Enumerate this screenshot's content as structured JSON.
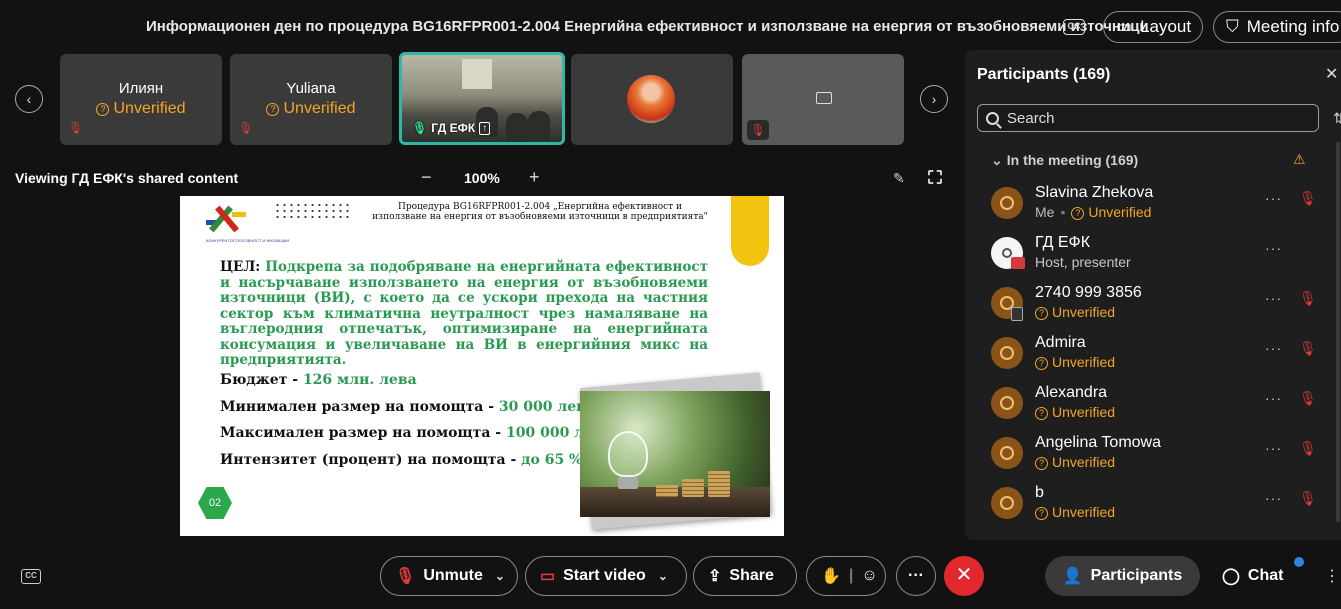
{
  "top": {
    "meeting_title": "Информационен ден по процедура BG16RFPR001-2.004 Енергийна ефективност и използване на енергия от възобновяеми източници",
    "cc_label": "CC",
    "layout_label": "Layout",
    "meeting_info_label": "Meeting info"
  },
  "thumbnails": [
    {
      "name": "Илиян",
      "status": "Unverified"
    },
    {
      "name": "Yuliana",
      "status": "Unverified"
    },
    {
      "name": "ГД ЕФК"
    },
    {
      "name": ""
    },
    {
      "name": ""
    }
  ],
  "share": {
    "viewing_label": "Viewing ГД ЕФК's shared content",
    "zoom": "100%",
    "zoom_minus": "−",
    "zoom_plus": "+"
  },
  "slide": {
    "header": "Процедура BG16RFPR001-2.004 „Енергийна ефективност и използване на енергия от възобновяеми източници в предприятията\"",
    "goal_label": "ЦЕЛ:",
    "goal_text": " Подкрепа за подобряване на енергийната ефективност и насърчаване използването на енергия от възобновяеми източници (ВИ), с което да се ускори прехода на частния сектор към климатична неутралност чрез намаляване на въглеродния отпечатък, оптимизиране на енергийната консумация и увеличаване на ВИ в енергийния микс на предприятията.",
    "rows": [
      {
        "label": "Бюджет - ",
        "value": "126 млн. лева"
      },
      {
        "label": "Минимален размер на помощта - ",
        "value": "30 000 лева"
      },
      {
        "label": "Максимален размер на помощта - ",
        "value": "100 000 лева"
      },
      {
        "label": "Интензитет (процент) на помощта - ",
        "value": "до 65 %"
      }
    ],
    "page_number": "02",
    "colors": {
      "accent_green": "#2a9a52",
      "accent_yellow": "#f2c40f"
    }
  },
  "panel": {
    "title": "Participants (169)",
    "search_placeholder": "Search",
    "section_label": "In the meeting (169)",
    "participants": [
      {
        "name": "Slavina Zhekova",
        "me": "Me",
        "status": "Unverified"
      },
      {
        "name": "ГД ЕФК",
        "status": "Host, presenter"
      },
      {
        "name": "2740 999 3856",
        "status": "Unverified"
      },
      {
        "name": "Admira",
        "status": "Unverified"
      },
      {
        "name": "Alexandra",
        "status": "Unverified"
      },
      {
        "name": "Angelina Tomowa",
        "status": "Unverified"
      },
      {
        "name": "b",
        "status": "Unverified"
      }
    ]
  },
  "controls": {
    "cc_label": "CC",
    "unmute": "Unmute",
    "start_video": "Start video",
    "share": "Share",
    "participants": "Participants",
    "chat": "Chat",
    "colors": {
      "end_call": "#e0282e",
      "muted": "#e23b3b",
      "unverified": "#f2a623"
    }
  }
}
